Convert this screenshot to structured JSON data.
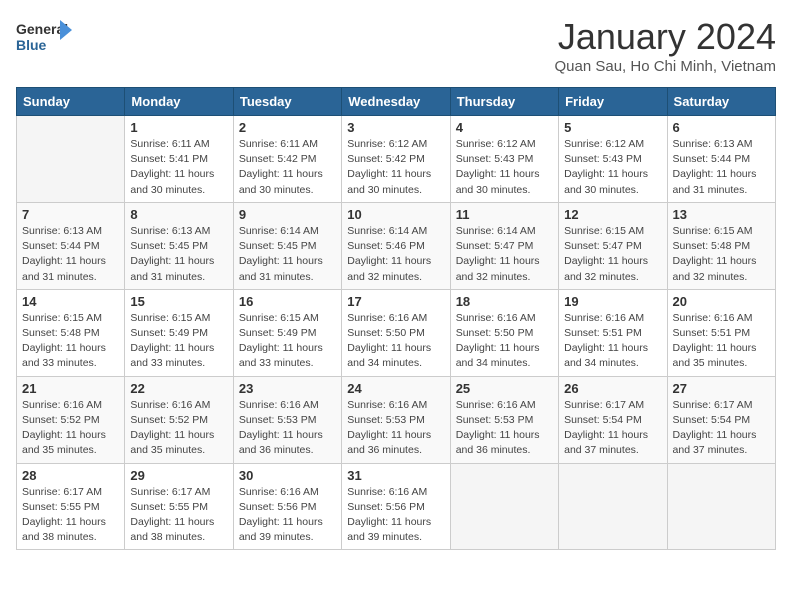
{
  "header": {
    "logo_line1": "General",
    "logo_line2": "Blue",
    "title": "January 2024",
    "subtitle": "Quan Sau, Ho Chi Minh, Vietnam"
  },
  "columns": [
    "Sunday",
    "Monday",
    "Tuesday",
    "Wednesday",
    "Thursday",
    "Friday",
    "Saturday"
  ],
  "weeks": [
    [
      {
        "day": "",
        "detail": ""
      },
      {
        "day": "1",
        "detail": "Sunrise: 6:11 AM\nSunset: 5:41 PM\nDaylight: 11 hours\nand 30 minutes."
      },
      {
        "day": "2",
        "detail": "Sunrise: 6:11 AM\nSunset: 5:42 PM\nDaylight: 11 hours\nand 30 minutes."
      },
      {
        "day": "3",
        "detail": "Sunrise: 6:12 AM\nSunset: 5:42 PM\nDaylight: 11 hours\nand 30 minutes."
      },
      {
        "day": "4",
        "detail": "Sunrise: 6:12 AM\nSunset: 5:43 PM\nDaylight: 11 hours\nand 30 minutes."
      },
      {
        "day": "5",
        "detail": "Sunrise: 6:12 AM\nSunset: 5:43 PM\nDaylight: 11 hours\nand 30 minutes."
      },
      {
        "day": "6",
        "detail": "Sunrise: 6:13 AM\nSunset: 5:44 PM\nDaylight: 11 hours\nand 31 minutes."
      }
    ],
    [
      {
        "day": "7",
        "detail": "Sunrise: 6:13 AM\nSunset: 5:44 PM\nDaylight: 11 hours\nand 31 minutes."
      },
      {
        "day": "8",
        "detail": "Sunrise: 6:13 AM\nSunset: 5:45 PM\nDaylight: 11 hours\nand 31 minutes."
      },
      {
        "day": "9",
        "detail": "Sunrise: 6:14 AM\nSunset: 5:45 PM\nDaylight: 11 hours\nand 31 minutes."
      },
      {
        "day": "10",
        "detail": "Sunrise: 6:14 AM\nSunset: 5:46 PM\nDaylight: 11 hours\nand 32 minutes."
      },
      {
        "day": "11",
        "detail": "Sunrise: 6:14 AM\nSunset: 5:47 PM\nDaylight: 11 hours\nand 32 minutes."
      },
      {
        "day": "12",
        "detail": "Sunrise: 6:15 AM\nSunset: 5:47 PM\nDaylight: 11 hours\nand 32 minutes."
      },
      {
        "day": "13",
        "detail": "Sunrise: 6:15 AM\nSunset: 5:48 PM\nDaylight: 11 hours\nand 32 minutes."
      }
    ],
    [
      {
        "day": "14",
        "detail": "Sunrise: 6:15 AM\nSunset: 5:48 PM\nDaylight: 11 hours\nand 33 minutes."
      },
      {
        "day": "15",
        "detail": "Sunrise: 6:15 AM\nSunset: 5:49 PM\nDaylight: 11 hours\nand 33 minutes."
      },
      {
        "day": "16",
        "detail": "Sunrise: 6:15 AM\nSunset: 5:49 PM\nDaylight: 11 hours\nand 33 minutes."
      },
      {
        "day": "17",
        "detail": "Sunrise: 6:16 AM\nSunset: 5:50 PM\nDaylight: 11 hours\nand 34 minutes."
      },
      {
        "day": "18",
        "detail": "Sunrise: 6:16 AM\nSunset: 5:50 PM\nDaylight: 11 hours\nand 34 minutes."
      },
      {
        "day": "19",
        "detail": "Sunrise: 6:16 AM\nSunset: 5:51 PM\nDaylight: 11 hours\nand 34 minutes."
      },
      {
        "day": "20",
        "detail": "Sunrise: 6:16 AM\nSunset: 5:51 PM\nDaylight: 11 hours\nand 35 minutes."
      }
    ],
    [
      {
        "day": "21",
        "detail": "Sunrise: 6:16 AM\nSunset: 5:52 PM\nDaylight: 11 hours\nand 35 minutes."
      },
      {
        "day": "22",
        "detail": "Sunrise: 6:16 AM\nSunset: 5:52 PM\nDaylight: 11 hours\nand 35 minutes."
      },
      {
        "day": "23",
        "detail": "Sunrise: 6:16 AM\nSunset: 5:53 PM\nDaylight: 11 hours\nand 36 minutes."
      },
      {
        "day": "24",
        "detail": "Sunrise: 6:16 AM\nSunset: 5:53 PM\nDaylight: 11 hours\nand 36 minutes."
      },
      {
        "day": "25",
        "detail": "Sunrise: 6:16 AM\nSunset: 5:53 PM\nDaylight: 11 hours\nand 36 minutes."
      },
      {
        "day": "26",
        "detail": "Sunrise: 6:17 AM\nSunset: 5:54 PM\nDaylight: 11 hours\nand 37 minutes."
      },
      {
        "day": "27",
        "detail": "Sunrise: 6:17 AM\nSunset: 5:54 PM\nDaylight: 11 hours\nand 37 minutes."
      }
    ],
    [
      {
        "day": "28",
        "detail": "Sunrise: 6:17 AM\nSunset: 5:55 PM\nDaylight: 11 hours\nand 38 minutes."
      },
      {
        "day": "29",
        "detail": "Sunrise: 6:17 AM\nSunset: 5:55 PM\nDaylight: 11 hours\nand 38 minutes."
      },
      {
        "day": "30",
        "detail": "Sunrise: 6:16 AM\nSunset: 5:56 PM\nDaylight: 11 hours\nand 39 minutes."
      },
      {
        "day": "31",
        "detail": "Sunrise: 6:16 AM\nSunset: 5:56 PM\nDaylight: 11 hours\nand 39 minutes."
      },
      {
        "day": "",
        "detail": ""
      },
      {
        "day": "",
        "detail": ""
      },
      {
        "day": "",
        "detail": ""
      }
    ]
  ]
}
